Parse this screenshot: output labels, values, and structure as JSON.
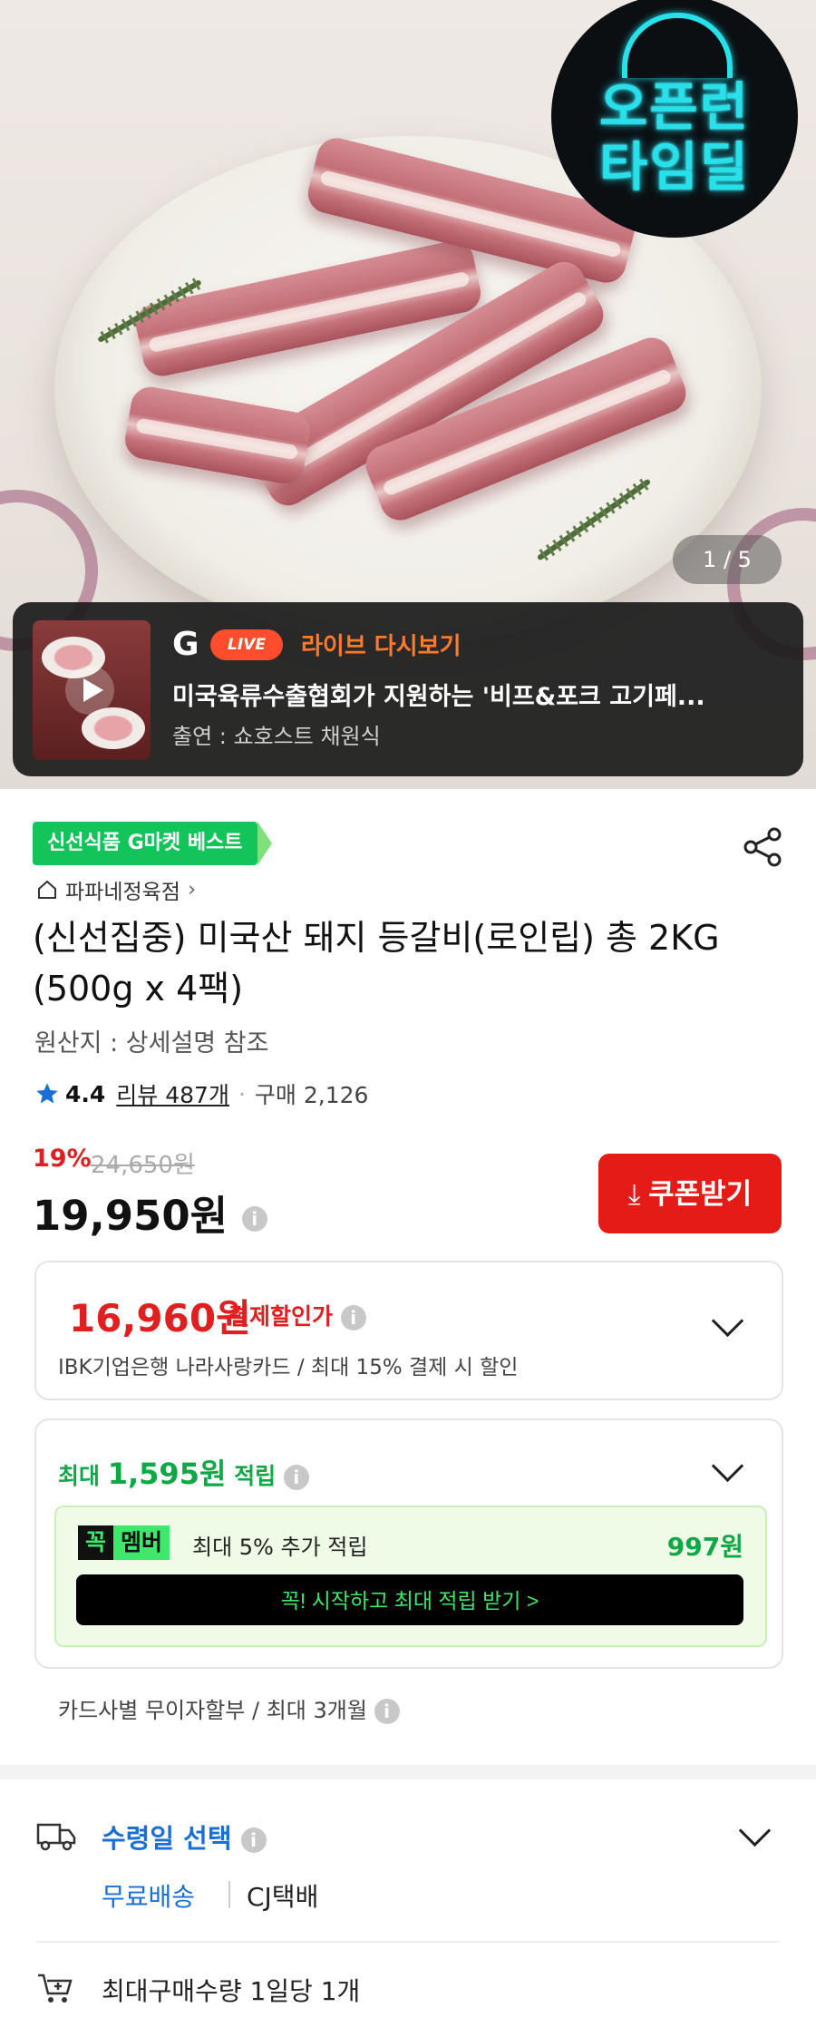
{
  "hero": {
    "deal_badge_line1": "오픈런",
    "deal_badge_line2": "타임딜",
    "image_counter": "1 / 5"
  },
  "live": {
    "badge": "LIVE",
    "label": "라이브 다시보기",
    "title": "미국육류수출협회가 지원하는 '비프&포크 고기페...",
    "host": "출연 : 쇼호스트 채원식"
  },
  "product": {
    "category_badge": "신선식품 G마켓 베스트",
    "store_name": "파파네정육점",
    "title": "(신선집중) 미국산 돼지 등갈비(로인립) 총 2KG (500g x 4팩)",
    "origin": "원산지 : 상세설명 참조",
    "rating": "4.4",
    "review_text": "리뷰 487개",
    "purchase_text": "구매 2,126",
    "discount_rate": "19%",
    "original_price": "24,650원",
    "price": "19,950원",
    "coupon_button": "쿠폰받기"
  },
  "payment_discount": {
    "price": "16,960원",
    "tag": "결제할인가",
    "description": "IBK기업은행 나라사랑카드 / 최대 15% 결제 시 할인"
  },
  "points": {
    "prefix": "최대",
    "amount": "1,595원",
    "suffix": "적립",
    "member_logo_a": "꼭",
    "member_logo_b": "멤버",
    "member_text": "최대 5% 추가 적립",
    "member_amount": "997원",
    "member_button": "꼭! 시작하고 최대 적립 받기 >"
  },
  "installment": "카드사별 무이자할부 / 최대 3개월",
  "delivery": {
    "receive_label": "수령일 선택",
    "shipping_free": "무료배송",
    "carrier": "CJ택배",
    "max_quantity": "최대구매수량 1일당 1개"
  },
  "colors": {
    "accent_red": "#e51b17",
    "points_green": "#0fa846",
    "link_blue": "#1a6fd6",
    "badge_green": "#13c45a"
  }
}
